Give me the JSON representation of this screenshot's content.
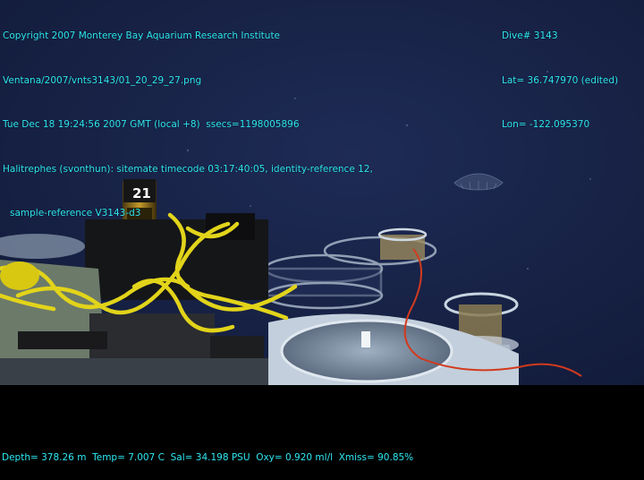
{
  "header_left": {
    "line1": "Copyright 2007 Monterey Bay Aquarium Research Institute",
    "line2": "Ventana/2007/vnts3143/01_20_29_27.png",
    "line3": "Tue Dec 18 19:24:56 2007 GMT (local +8)  ssecs=1198005896",
    "line4": "Halitrephes (svonthun): sitemate timecode 03:17:40:05, identity-reference 12,",
    "line5": "sample-reference V3143-d3"
  },
  "header_right": {
    "dive": "Dive# 3143",
    "lat": "Lat= 36.747970 (edited)",
    "lon": "Lon= -122.095370"
  },
  "footer": {
    "telemetry": "Depth= 378.26 m  Temp= 7.007 C  Sal= 34.198 PSU  Oxy= 0.920 ml/l  Xmiss= 90.85%"
  },
  "scene": {
    "water_color": "#18244a",
    "label_on_bottle": "21",
    "overlay_color": "#2ee8f2"
  }
}
